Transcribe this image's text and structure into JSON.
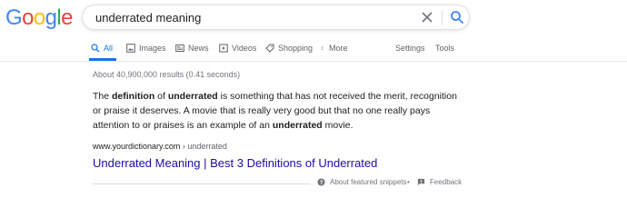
{
  "logo": {
    "letters": [
      "G",
      "o",
      "o",
      "g",
      "l",
      "e"
    ],
    "colors": [
      "#4285f4",
      "#ea4335",
      "#fbbc05",
      "#4285f4",
      "#34a853",
      "#ea4335"
    ]
  },
  "search": {
    "value": "underrated meaning"
  },
  "tabs": [
    {
      "label": "All",
      "icon": "search-icon",
      "active": true
    },
    {
      "label": "Images",
      "icon": "image-icon"
    },
    {
      "label": "News",
      "icon": "newspaper-icon"
    },
    {
      "label": "Videos",
      "icon": "play-icon"
    },
    {
      "label": "Shopping",
      "icon": "tag-icon"
    },
    {
      "label": "More",
      "icon": "more-vert-icon"
    },
    {
      "label": "Settings"
    },
    {
      "label": "Tools"
    }
  ],
  "stats": "About 40,900,000 results (0.41 seconds)",
  "snippet": {
    "parts": [
      {
        "text": "The ",
        "bold": false
      },
      {
        "text": "definition",
        "bold": true
      },
      {
        "text": " of ",
        "bold": false
      },
      {
        "text": "underrated",
        "bold": true
      },
      {
        "text": " is something that has not received the merit, recognition or praise it deserves. A movie that is really very good but that no one really pays attention to or praises is an example of an ",
        "bold": false
      },
      {
        "text": "underrated",
        "bold": true
      },
      {
        "text": " movie.",
        "bold": false
      }
    ]
  },
  "result": {
    "domain": "www.yourdictionary.com",
    "breadcrumb": " › underrated",
    "title": "Underrated Meaning | Best 3 Definitions of Underrated"
  },
  "footer": {
    "about": "About featured snippets",
    "separator": "•",
    "feedback": "Feedback"
  },
  "colors": {
    "link": "#1a0dab",
    "accent": "#1a73e8"
  }
}
